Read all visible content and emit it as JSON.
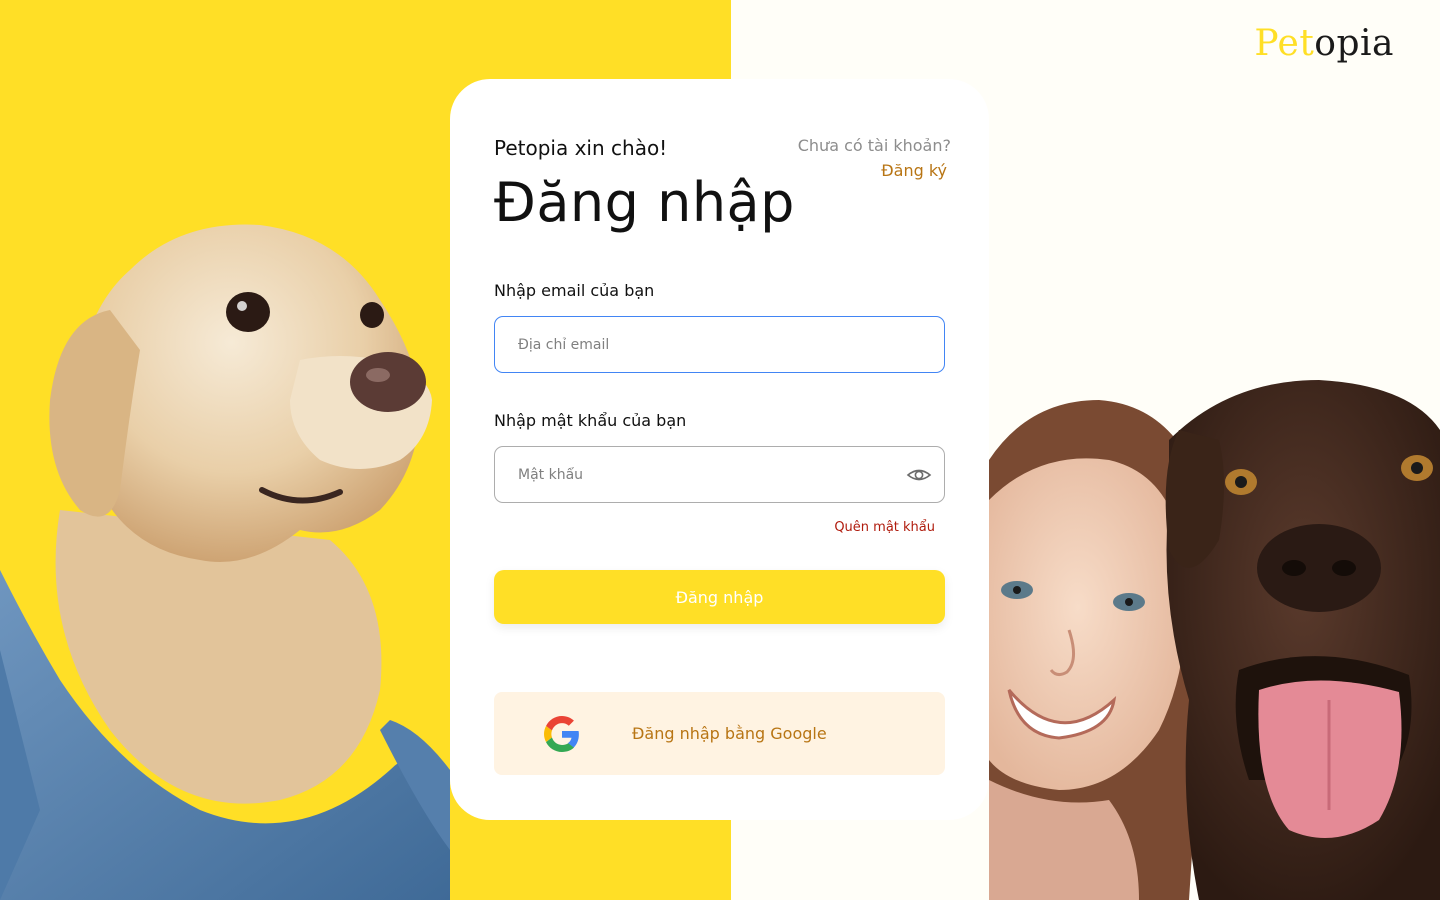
{
  "brand": {
    "name_part1": "Pet",
    "name_part2": "opia"
  },
  "login": {
    "greeting": "Petopia xin chào!",
    "title": "Đăng nhập",
    "no_account_text": "Chưa có tài khoản?",
    "signup_link": "Đăng ký",
    "email_label": "Nhập email của bạn",
    "email_placeholder": "Địa chỉ email",
    "email_value": "",
    "password_label": "Nhập mật khẩu của bạn",
    "password_placeholder": "Mật khẩu",
    "password_value": "",
    "forgot_link": "Quên mật khẩu",
    "submit_label": "Đăng nhập",
    "google_label": "Đăng nhập bằng Google"
  },
  "icons": {
    "password_toggle": "eye-icon",
    "google": "google-logo-icon"
  },
  "colors": {
    "accent_yellow": "#FFDF26",
    "link_brown": "#B87514",
    "error_red": "#B01C0E",
    "google_bg": "#FFF3E2",
    "focus_blue": "#4285F4"
  }
}
